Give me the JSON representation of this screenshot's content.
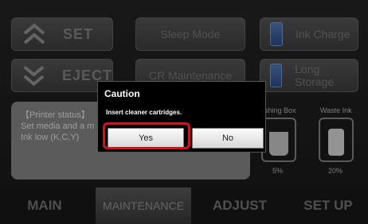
{
  "top_buttons": {
    "set_label": "SET",
    "eject_label": "EJECT",
    "sleep_label": "Sleep Mode",
    "cr_label": "CR Maintenance",
    "ink_charge_label": "Ink Charge",
    "long_storage_label": "Long Storage"
  },
  "status_panel": {
    "heading": "【Printer status】",
    "line1": "Set media and a m",
    "line2": "Ink low (K,C,Y)"
  },
  "ink_area": {
    "flushing_label": "shing Box",
    "waste_label": "Waste Ink",
    "flushing_pct": "5%",
    "waste_pct": "20%"
  },
  "nav": {
    "main": "MAIN",
    "maintenance": "MAINTENANCE",
    "adjust": "ADJUST",
    "setup": "SET UP"
  },
  "dialog": {
    "title": "Caution",
    "message": "Insert cleaner cartridges.",
    "yes_label": "Yes",
    "no_label": "No"
  },
  "colors": {
    "highlight": "#d0141b",
    "status_panel_bg": "#8c8c8c"
  }
}
